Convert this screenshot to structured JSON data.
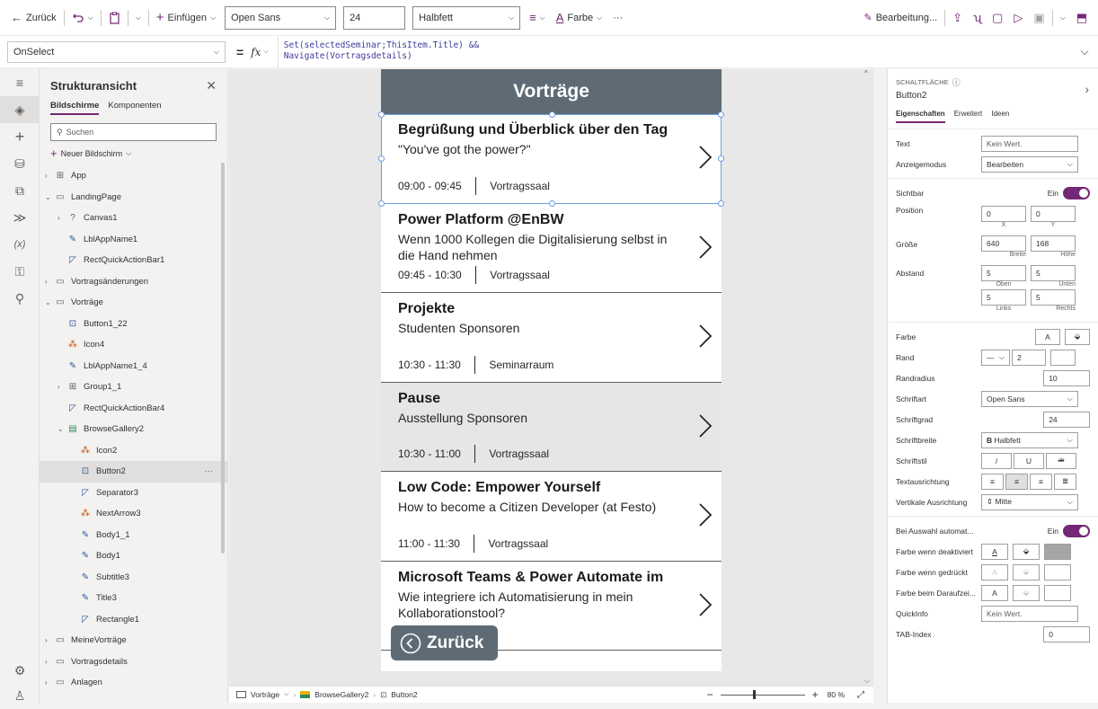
{
  "toolbar": {
    "back": "Zurück",
    "insert": "Einfügen",
    "font": "Open Sans",
    "font_size": "24",
    "weight": "Halbfett",
    "color": "Farbe",
    "more": "···",
    "edit": "Bearbeitung..."
  },
  "formula": {
    "property": "OnSelect",
    "fx": "fx",
    "line1": "Set(selectedSeminar;ThisItem.Title) &&",
    "line2": "Navigate(Vortragsdetails)"
  },
  "tree": {
    "title": "Strukturansicht",
    "tab_screens": "Bildschirme",
    "tab_components": "Komponenten",
    "search_placeholder": "Suchen",
    "new_screen": "Neuer Bildschirm",
    "items": [
      {
        "label": "App",
        "icon": "app-icon",
        "indent": 0,
        "chev": "›"
      },
      {
        "label": "LandingPage",
        "icon": "screen-icon",
        "indent": 0,
        "chev": "⌄"
      },
      {
        "label": "Canvas1",
        "icon": "help-circle-icon",
        "indent": 1,
        "chev": "›"
      },
      {
        "label": "LblAppName1",
        "icon": "label-icon",
        "indent": 1,
        "chev": ""
      },
      {
        "label": "RectQuickActionBar1",
        "icon": "shape-icon",
        "indent": 1,
        "chev": ""
      },
      {
        "label": "Vortragsänderungen",
        "icon": "screen-icon",
        "indent": 0,
        "chev": "›"
      },
      {
        "label": "Vorträge",
        "icon": "screen-icon",
        "indent": 0,
        "chev": "⌄"
      },
      {
        "label": "Button1_22",
        "icon": "button-icon",
        "indent": 1,
        "chev": ""
      },
      {
        "label": "Icon4",
        "icon": "icon-icon",
        "indent": 1,
        "chev": ""
      },
      {
        "label": "LblAppName1_4",
        "icon": "label-icon",
        "indent": 1,
        "chev": ""
      },
      {
        "label": "Group1_1",
        "icon": "group-icon",
        "indent": 1,
        "chev": "›"
      },
      {
        "label": "RectQuickActionBar4",
        "icon": "shape-icon",
        "indent": 1,
        "chev": ""
      },
      {
        "label": "BrowseGallery2",
        "icon": "gallery-icon",
        "indent": 1,
        "chev": "⌄"
      },
      {
        "label": "Icon2",
        "icon": "icon-icon",
        "indent": 2,
        "chev": ""
      },
      {
        "label": "Button2",
        "icon": "button-icon",
        "indent": 2,
        "chev": "",
        "selected": true
      },
      {
        "label": "Separator3",
        "icon": "shape-icon",
        "indent": 2,
        "chev": ""
      },
      {
        "label": "NextArrow3",
        "icon": "icon-icon",
        "indent": 2,
        "chev": ""
      },
      {
        "label": "Body1_1",
        "icon": "label-icon",
        "indent": 2,
        "chev": ""
      },
      {
        "label": "Body1",
        "icon": "label-icon",
        "indent": 2,
        "chev": ""
      },
      {
        "label": "Subtitle3",
        "icon": "label-icon",
        "indent": 2,
        "chev": ""
      },
      {
        "label": "Title3",
        "icon": "label-icon",
        "indent": 2,
        "chev": ""
      },
      {
        "label": "Rectangle1",
        "icon": "shape-icon",
        "indent": 2,
        "chev": ""
      },
      {
        "label": "MeineVorträge",
        "icon": "screen-icon",
        "indent": 0,
        "chev": "›"
      },
      {
        "label": "Vortragsdetails",
        "icon": "screen-icon",
        "indent": 0,
        "chev": "›"
      },
      {
        "label": "Anlagen",
        "icon": "screen-icon",
        "indent": 0,
        "chev": "›"
      }
    ]
  },
  "app": {
    "header": "Vorträge",
    "items": [
      {
        "title": "Begrüßung und Überblick über den Tag",
        "subtitle": "\"You've got the power?\"",
        "time": "09:00 - 09:45",
        "room": "Vortragssaal",
        "pause": false
      },
      {
        "title": "Power Platform @EnBW",
        "subtitle": "Wenn 1000 Kollegen die Digitalisierung selbst in die Hand nehmen",
        "time": "09:45 - 10:30",
        "room": "Vortragssaal",
        "pause": false
      },
      {
        "title": "Projekte",
        "subtitle": "Studenten Sponsoren",
        "time": "10:30 - 11:30",
        "room": "Seminarraum",
        "pause": false
      },
      {
        "title": "Pause",
        "subtitle": "Ausstellung Sponsoren",
        "time": "10:30 - 11:00",
        "room": "Vortragssaal",
        "pause": true
      },
      {
        "title": "Low Code: Empower Yourself",
        "subtitle": "How to become a Citizen Developer (at Festo)",
        "time": "11:00 - 11:30",
        "room": "Vortragssaal",
        "pause": false
      },
      {
        "title": "Microsoft Teams & Power Automate im",
        "subtitle": "Wie integriere ich Automatisierung in mein Kollaborationstool?",
        "time": "",
        "room": "",
        "pause": false
      }
    ],
    "back_button": "Zurück"
  },
  "status": {
    "screen": "Vorträge",
    "gallery": "BrowseGallery2",
    "control": "Button2",
    "zoom": "80 %",
    "minus": "−",
    "plus": "+",
    "zoom_level": 0.4
  },
  "props": {
    "type": "SCHALTFLÄCHE",
    "name": "Button2",
    "tab_props": "Eigenschaften",
    "tab_adv": "Erweitert",
    "tab_ideas": "Ideen",
    "text_label": "Text",
    "text_value": "Kein Wert.",
    "mode_label": "Anzeigemodus",
    "mode_value": "Bearbeiten",
    "visible_label": "Sichtbar",
    "visible_value": "Ein",
    "position_label": "Position",
    "pos_x": "0",
    "pos_y": "0",
    "x": "X",
    "y": "Y",
    "size_label": "Größe",
    "width": "640",
    "height": "168",
    "width_lbl": "Breite",
    "height_lbl": "Höhe",
    "padding_label": "Abstand",
    "pad_top": "5",
    "pad_bottom": "5",
    "pad_left": "5",
    "pad_right": "5",
    "top_lbl": "Oben",
    "bottom_lbl": "Unten",
    "left_lbl": "Links",
    "right_lbl": "Rechts",
    "color_label": "Farbe",
    "border_label": "Rand",
    "border_value": "2",
    "radius_label": "Randradius",
    "radius_value": "10",
    "font_label": "Schriftart",
    "font_value": "Open Sans",
    "fontsize_label": "Schriftgrad",
    "fontsize_value": "24",
    "weight_label": "Schriftbreite",
    "weight_value": "Halbfett",
    "style_label": "Schriftstil",
    "align_label": "Textausrichtung",
    "valign_label": "Vertikale Ausrichtung",
    "valign_value": "Mitte",
    "autodisable_label": "Bei Auswahl automat...",
    "autodisable_value": "Ein",
    "disabled_color_label": "Farbe wenn deaktiviert",
    "pressed_color_label": "Farbe wenn gedrückt",
    "hover_color_label": "Farbe beim Daraufzei...",
    "tooltip_label": "QuickInfo",
    "tooltip_value": "Kein Wert.",
    "tab_index_label": "TAB-Index",
    "tab_index_value": "0",
    "a": "A",
    "bold_b": "B",
    "italic": "/",
    "underline": "U",
    "strike": "ab"
  },
  "colors": {
    "accent": "#742774",
    "header": "#5e6b74",
    "selection": "#6b9ee0"
  }
}
